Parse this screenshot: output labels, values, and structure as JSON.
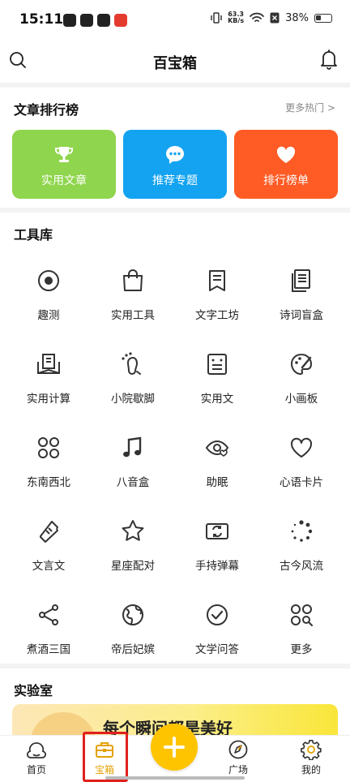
{
  "status_bar": {
    "time": "15:11",
    "net_speed_value": "63.3",
    "net_speed_unit": "KB/s",
    "battery": "38%"
  },
  "header": {
    "title": "百宝箱"
  },
  "articles": {
    "title": "文章排行榜",
    "more": "更多热门 >",
    "buttons": [
      {
        "label": "实用文章",
        "icon": "trophy-icon",
        "color": "#8fd54d"
      },
      {
        "label": "推荐专题",
        "icon": "chat-bubble-icon",
        "color": "#13a3f1"
      },
      {
        "label": "排行榜单",
        "icon": "heart-icon",
        "color": "#ff5b24"
      }
    ]
  },
  "tools": {
    "title": "工具库",
    "items": [
      {
        "label": "趣测",
        "icon": "target-icon"
      },
      {
        "label": "实用工具",
        "icon": "shopping-bag-icon"
      },
      {
        "label": "文字工坊",
        "icon": "bookmark-book-icon"
      },
      {
        "label": "诗词盲盒",
        "icon": "document-stack-icon"
      },
      {
        "label": "实用计算",
        "icon": "reading-book-icon"
      },
      {
        "label": "小院歇脚",
        "icon": "footprint-icon"
      },
      {
        "label": "实用文",
        "icon": "text-box-icon"
      },
      {
        "label": "小画板",
        "icon": "palette-icon"
      },
      {
        "label": "东南西北",
        "icon": "four-circles-icon"
      },
      {
        "label": "八音盒",
        "icon": "music-note-icon"
      },
      {
        "label": "助眠",
        "icon": "eye-heart-icon"
      },
      {
        "label": "心语卡片",
        "icon": "heart-outline-icon"
      },
      {
        "label": "文言文",
        "icon": "ticket-icon"
      },
      {
        "label": "星座配对",
        "icon": "star-icon"
      },
      {
        "label": "手持弹幕",
        "icon": "rotate-screen-icon"
      },
      {
        "label": "古今风流",
        "icon": "dots-spinner-icon"
      },
      {
        "label": "煮酒三国",
        "icon": "share-nodes-icon"
      },
      {
        "label": "帝后妃嫔",
        "icon": "globe-icon"
      },
      {
        "label": "文学问答",
        "icon": "check-circle-icon"
      },
      {
        "label": "更多",
        "icon": "grid-search-icon"
      }
    ]
  },
  "lab": {
    "title": "实验室",
    "banner_text": "每个瞬间都是美好"
  },
  "tabbar": {
    "items": [
      {
        "label": "首页",
        "icon": "cloud-home-icon"
      },
      {
        "label": "宝箱",
        "icon": "toolbox-icon",
        "active": true
      },
      {
        "label": "广场",
        "icon": "compass-disc-icon"
      },
      {
        "label": "我的",
        "icon": "gear-icon"
      }
    ],
    "accent": "#ffc400",
    "active_color": "#e3a100"
  }
}
